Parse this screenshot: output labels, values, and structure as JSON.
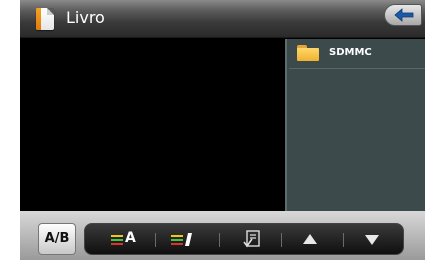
{
  "window": {
    "title": "Livro"
  },
  "file_list": {
    "items": [
      {
        "label": "SDMMC",
        "icon": "folder-icon"
      }
    ]
  },
  "toolbar": {
    "ab_label": "A/B",
    "a_label": "A",
    "buttons": [
      "color-lines-a-icon",
      "color-lines-pen-icon",
      "document-check-icon",
      "up-arrow-icon",
      "down-arrow-icon"
    ]
  },
  "colors": {
    "folder": "#f0b030",
    "file_pane": "#3d4a4b",
    "accent_blue": "#1a5aa8"
  }
}
